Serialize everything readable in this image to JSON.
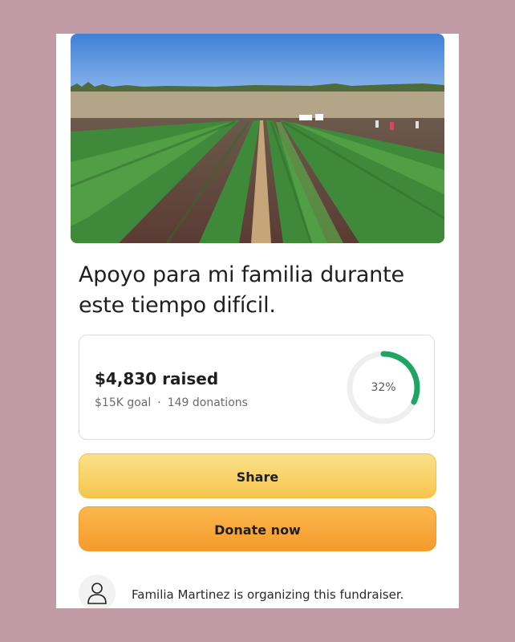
{
  "campaign": {
    "title": "Apoyo para mi familia durante este tiempo difícil.",
    "hero_image": "strawberry-field-photo"
  },
  "progress": {
    "raised_text": "$4,830 raised",
    "goal_text": "$15K goal",
    "separator": "·",
    "donations_text": "149 donations",
    "percent_label": "32%",
    "percent_value": 32,
    "ring_color": "#1fa463",
    "ring_track_color": "#efefef"
  },
  "actions": {
    "share_label": "Share",
    "donate_label": "Donate now"
  },
  "organizer": {
    "text": "Familia Martinez is organizing this fundraiser.",
    "icon": "user-icon"
  },
  "colors": {
    "background": "#c09aa5",
    "share_button": "#f6c64d",
    "donate_button": "#f59a2d"
  }
}
